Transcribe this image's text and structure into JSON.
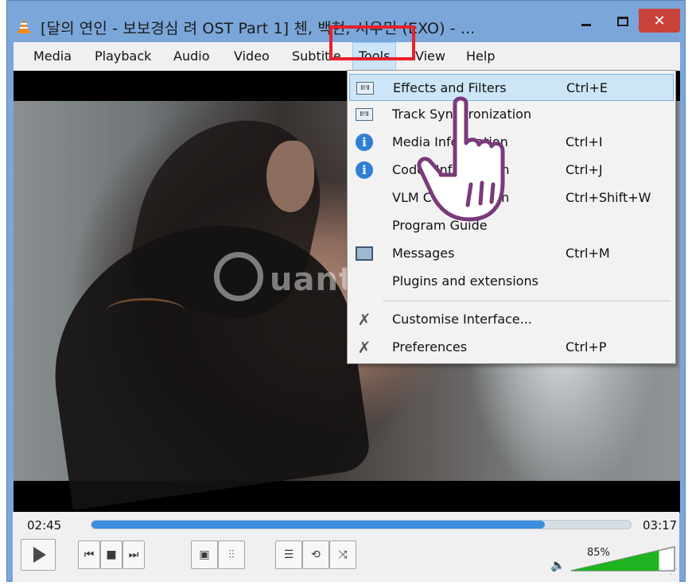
{
  "window": {
    "title": "[달의 연인 - 보보경심 려 OST Part 1] 첸, 백현, 시우민 (EXO) - ...",
    "minimize": "–",
    "maximize": "□",
    "close": "✕"
  },
  "menubar": {
    "items": [
      {
        "label": "Media",
        "name": "menu-media"
      },
      {
        "label": "Playback",
        "name": "menu-playback"
      },
      {
        "label": "Audio",
        "name": "menu-audio"
      },
      {
        "label": "Video",
        "name": "menu-video"
      },
      {
        "label": "Subtitle",
        "name": "menu-subtitle"
      },
      {
        "label": "Tools",
        "name": "menu-tools"
      },
      {
        "label": "View",
        "name": "menu-view"
      },
      {
        "label": "Help",
        "name": "menu-help"
      }
    ]
  },
  "tools_menu": {
    "items": [
      {
        "label": "Effects and Filters",
        "shortcut": "Ctrl+E",
        "icon": "equalizer-icon"
      },
      {
        "label": "Track Synchronization",
        "shortcut": "",
        "icon": "equalizer-icon"
      },
      {
        "label": "Media Information",
        "shortcut": "Ctrl+I",
        "icon": "info-icon"
      },
      {
        "label": "Codec Information",
        "shortcut": "Ctrl+J",
        "icon": "info-icon"
      },
      {
        "label": "VLM Configuration",
        "shortcut": "Ctrl+Shift+W",
        "icon": ""
      },
      {
        "label": "Program Guide",
        "shortcut": "",
        "icon": ""
      },
      {
        "label": "Messages",
        "shortcut": "Ctrl+M",
        "icon": "console-icon"
      },
      {
        "label": "Plugins and extensions",
        "shortcut": "",
        "icon": ""
      },
      {
        "label": "Customise Interface...",
        "shortcut": "",
        "icon": "tools-icon"
      },
      {
        "label": "Preferences",
        "shortcut": "Ctrl+P",
        "icon": "tools-icon"
      }
    ]
  },
  "watermark": {
    "text": "uantrimang"
  },
  "player": {
    "current_time": "02:45",
    "total_time": "03:17",
    "progress": 0.84,
    "volume": "85%",
    "volume_level": 0.85
  },
  "colors": {
    "titlebar": "#7ba6d9",
    "close": "#c9433a",
    "seek_fill": "#3b8ee0",
    "volume_fill": "#1fb322",
    "highlight": "#e8202a"
  }
}
